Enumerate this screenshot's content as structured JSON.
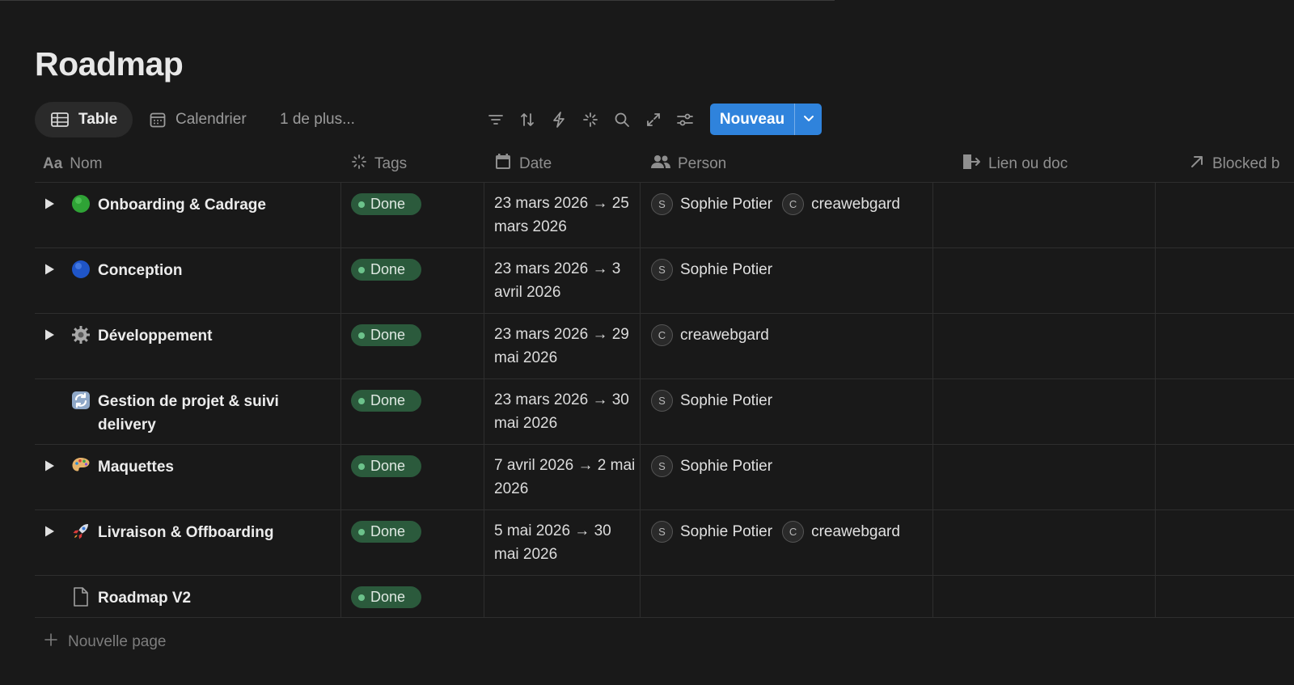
{
  "page": {
    "title": "Roadmap"
  },
  "toolbar": {
    "views": [
      {
        "label": "Table",
        "icon": "table-icon"
      },
      {
        "label": "Calendrier",
        "icon": "calendar-icon"
      },
      {
        "label": "1 de plus..."
      }
    ],
    "tools": [
      "filter-icon",
      "sort-icon",
      "automation-icon",
      "ai-sparkle-icon",
      "search-icon",
      "expand-icon",
      "settings-icon"
    ],
    "new_button": "Nouveau"
  },
  "table": {
    "columns": [
      {
        "label": "Nom",
        "icon": "text-type-icon"
      },
      {
        "label": "Tags",
        "icon": "status-icon"
      },
      {
        "label": "Date",
        "icon": "calendar-icon"
      },
      {
        "label": "Person",
        "icon": "people-icon"
      },
      {
        "label": "Lien ou doc",
        "icon": "relation-icon"
      },
      {
        "label": "Blocked b",
        "icon": "arrow-up-right-icon"
      }
    ],
    "rows": [
      {
        "name": "Onboarding & Cadrage",
        "emoji": "green-circle",
        "has_toggle": true,
        "tag": "Done",
        "date": "23 mars 2026 → 25 mars 2026",
        "persons": [
          {
            "initial": "S",
            "name": "Sophie Potier"
          },
          {
            "initial": "C",
            "name": "creawebgard"
          }
        ]
      },
      {
        "name": "Conception",
        "emoji": "blue-circle",
        "has_toggle": true,
        "tag": "Done",
        "date": "23 mars 2026 → 3 avril 2026",
        "persons": [
          {
            "initial": "S",
            "name": "Sophie Potier"
          }
        ]
      },
      {
        "name": "Développement",
        "emoji": "gear",
        "has_toggle": true,
        "tag": "Done",
        "date": "23 mars 2026 → 29 mai 2026",
        "persons": [
          {
            "initial": "C",
            "name": "creawebgard"
          }
        ]
      },
      {
        "name": "Gestion de projet & suivi delivery",
        "emoji": "repeat",
        "has_toggle": false,
        "tag": "Done",
        "date": "23 mars 2026 → 30 mai 2026",
        "persons": [
          {
            "initial": "S",
            "name": "Sophie Potier"
          }
        ]
      },
      {
        "name": "Maquettes",
        "emoji": "palette",
        "has_toggle": true,
        "tag": "Done",
        "date": "7 avril 2026 → 2 mai 2026",
        "persons": [
          {
            "initial": "S",
            "name": "Sophie Potier"
          }
        ]
      },
      {
        "name": "Livraison & Offboarding",
        "emoji": "rocket",
        "has_toggle": true,
        "tag": "Done",
        "date": "5 mai 2026 → 30 mai 2026",
        "persons": [
          {
            "initial": "S",
            "name": "Sophie Potier"
          },
          {
            "initial": "C",
            "name": "creawebgard"
          }
        ]
      },
      {
        "name": "Roadmap V2",
        "emoji": "page",
        "has_toggle": false,
        "tag": "Done",
        "date": "",
        "persons": []
      }
    ],
    "new_page_label": "Nouvelle page"
  },
  "colors": {
    "background": "#191919",
    "accent": "#2f83dc",
    "tag_done_bg": "#2b5a3c",
    "tag_done_dot": "#6cc28b"
  }
}
